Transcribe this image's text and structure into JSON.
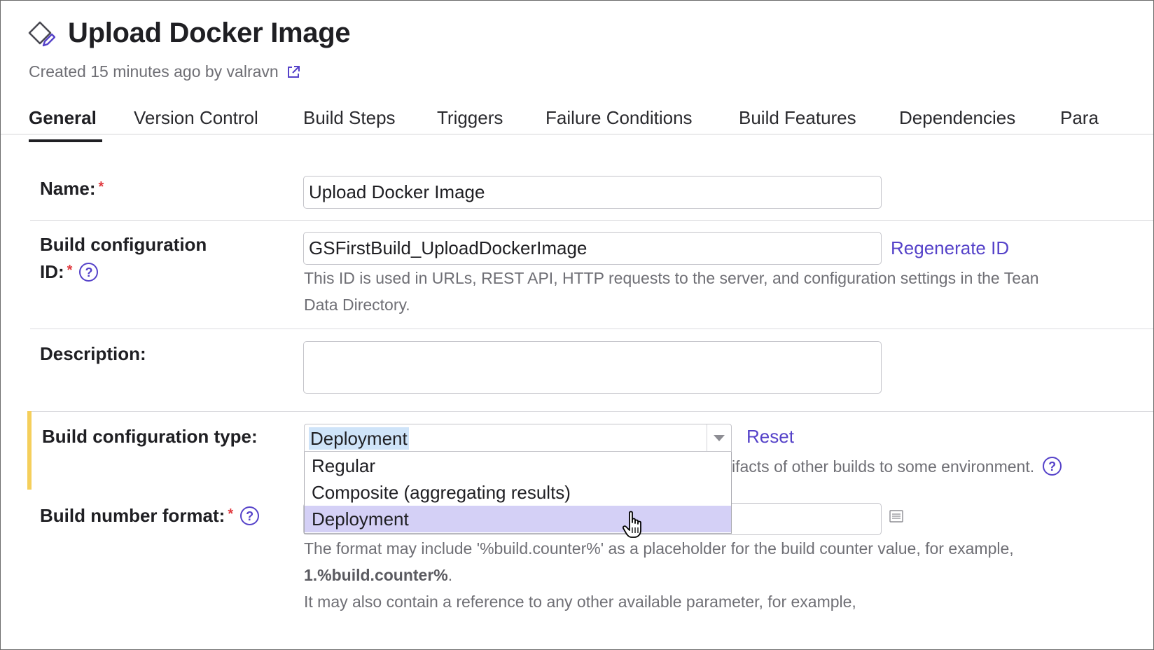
{
  "header": {
    "title": "Upload Docker Image",
    "subtitle": "Created 15 minutes ago by valravn",
    "title_icon": "build-config-edit-icon",
    "external_link_icon": "external-link-icon"
  },
  "tabs": [
    {
      "label": "General",
      "active": true
    },
    {
      "label": "Version Control",
      "active": false
    },
    {
      "label": "Build Steps",
      "active": false
    },
    {
      "label": "Triggers",
      "active": false
    },
    {
      "label": "Failure Conditions",
      "active": false
    },
    {
      "label": "Build Features",
      "active": false
    },
    {
      "label": "Dependencies",
      "active": false
    },
    {
      "label": "Para",
      "active": false
    }
  ],
  "form": {
    "name": {
      "label": "Name:",
      "required_mark": "*",
      "value": "Upload Docker Image"
    },
    "build_id": {
      "label_line1": "Build configuration",
      "label_line2": "ID:",
      "required_mark": "*",
      "help": "?",
      "value": "GSFirstBuild_UploadDockerImage",
      "action": "Regenerate ID",
      "hint_line1": "This ID is used in URLs, REST API, HTTP requests to the server, and configuration settings in the Tean",
      "hint_line2": "Data Directory."
    },
    "description": {
      "label": "Description:",
      "value": ""
    },
    "build_type": {
      "label": "Build configuration type:",
      "selected": "Deployment",
      "action": "Reset",
      "hint_visible": "ifacts of other builds to some environment.",
      "help": "?",
      "options": [
        "Regular",
        "Composite (aggregating results)",
        "Deployment"
      ],
      "highlighted_option": "Deployment"
    },
    "build_number": {
      "label": "Build number format:",
      "required_mark": "*",
      "help": "?",
      "value": "",
      "hint_line1": "The format may include '%build.counter%' as a placeholder for the build counter value, for example,",
      "hint_line2_bold": "1.%build.counter%",
      "hint_line2_end": ".",
      "hint_line3": "It may also contain a reference to any other available parameter, for example,"
    }
  },
  "colors": {
    "accent": "#5542c9",
    "required": "#e0393e",
    "modified_marker": "#f5cf5b",
    "option_highlight": "#d4d0f6",
    "text_selection": "#cfe4f9"
  }
}
